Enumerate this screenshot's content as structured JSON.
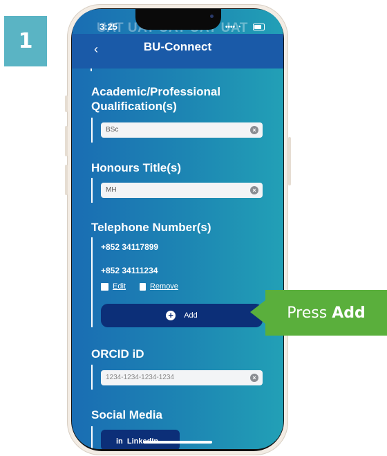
{
  "step_badge": "1",
  "status_bar": {
    "time": "3:25",
    "watermark": "UAT UAT UAT UAT UAT",
    "signal": "•••• ◔"
  },
  "app": {
    "back_icon": "chevron-left-icon",
    "back_glyph": "‹",
    "title": "BU-Connect"
  },
  "qualifications": {
    "label_line1": "Academic/Professional",
    "label_line2": "Qualification(s)",
    "value": "BSc"
  },
  "honours": {
    "label": "Honours Title(s)",
    "value": "MH"
  },
  "telephone": {
    "label": "Telephone Number(s)",
    "numbers": [
      "+852 34117899",
      "+852 34111234"
    ],
    "edit_label": "Edit",
    "remove_label": "Remove",
    "add_label": "Add"
  },
  "orcid": {
    "label": "ORCID iD",
    "placeholder": "1234-1234-1234-1234"
  },
  "social": {
    "label": "Social Media",
    "linkedin_label": "in  LinkedIn"
  },
  "clear_glyph": "×",
  "callout": {
    "text": "Press",
    "bold": "Add"
  },
  "colors": {
    "callout": "#5aaf3c",
    "badge": "#5ab4c4",
    "button": "#0c2f78",
    "header": "#1a5aa8"
  }
}
